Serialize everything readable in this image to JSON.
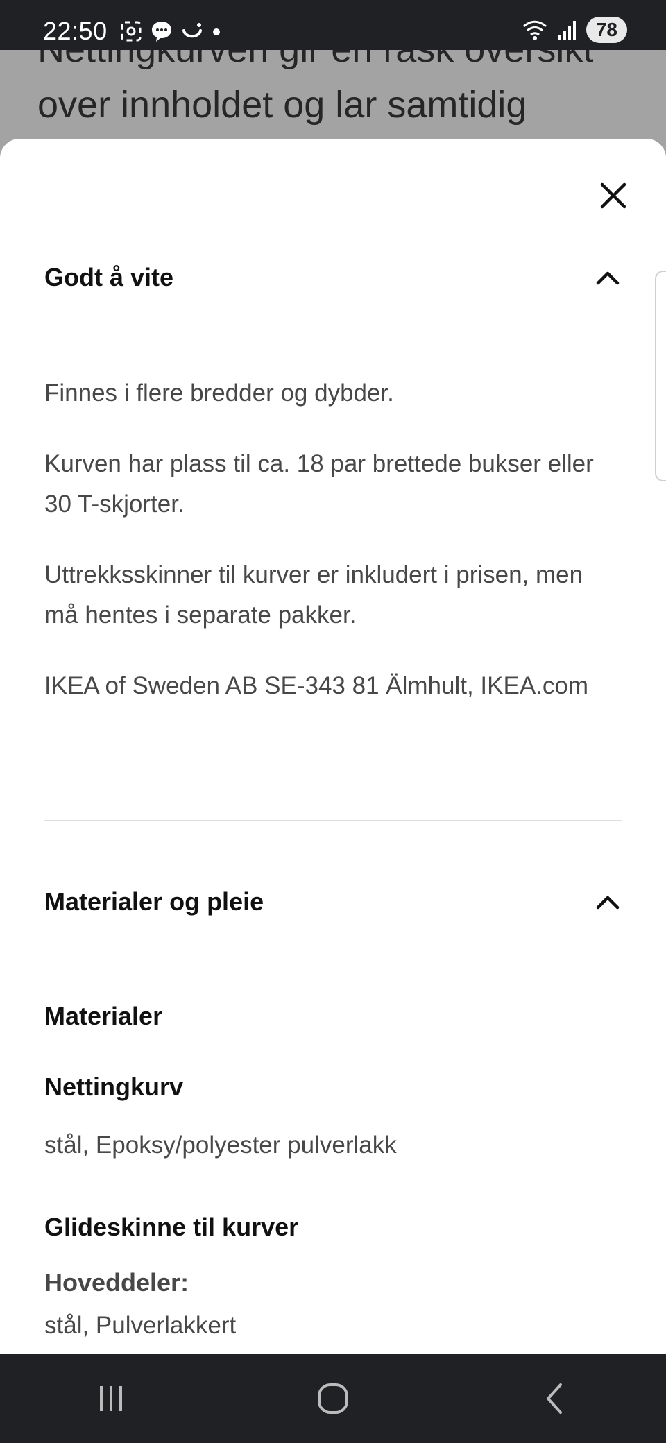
{
  "status_bar": {
    "time": "22:50",
    "battery": "78",
    "icons": [
      "screenshot-icon",
      "chat-bubble-icon",
      "smile-icon",
      "dot-icon",
      "wifi-icon",
      "signal-icon"
    ]
  },
  "background_page": {
    "line1": "Nettingkurven gir en rask oversikt",
    "line2": "over innholdet og lar samtidig"
  },
  "sheet": {
    "sections": [
      {
        "title": "Godt å vite",
        "paragraphs": [
          "Finnes i flere bredder og dybder.",
          "Kurven har plass til ca. 18 par brettede bukser eller 30 T-skjorter.",
          "Uttrekksskinner til kurver er inkludert i prisen, men må hentes i separate pakker.",
          "IKEA of Sweden AB SE-343 81 Älmhult, IKEA.com"
        ]
      },
      {
        "title": "Materialer og pleie",
        "materials_heading": "Materialer",
        "items": [
          {
            "name": "Nettingkurv",
            "value": "stål, Epoksy/polyester pulverlakk"
          },
          {
            "name": "Glideskinne til kurver",
            "part": "Hoveddeler:",
            "value": "stål, Pulverlakkert"
          }
        ]
      }
    ]
  },
  "colors": {
    "status_bar_bg": "#202124",
    "overlay": "#a3a3a3",
    "sheet_bg": "#ffffff",
    "text_primary": "#111111",
    "text_secondary": "#484848"
  }
}
